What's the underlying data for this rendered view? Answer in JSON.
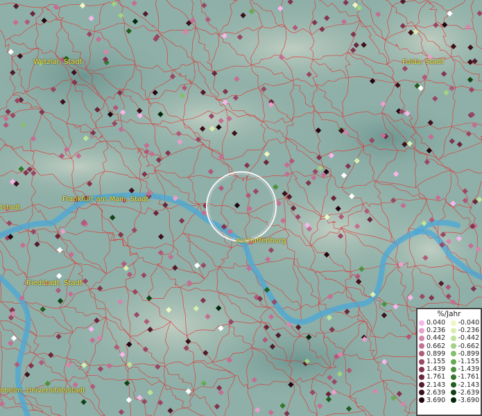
{
  "map": {
    "cities": [
      {
        "id": "wetzlar",
        "label": "Wetzlar, Stadt"
      },
      {
        "id": "fulda",
        "label": "Fulda, Stadt"
      },
      {
        "id": "frankfurt",
        "label": "Frankfurt am Main, Stadt"
      },
      {
        "id": "offenbach",
        "label": "tstadt"
      },
      {
        "id": "aschaffenburg",
        "label": "Aschaffenburg"
      },
      {
        "id": "riedstadt",
        "label": "Riedstadt, Stadt"
      },
      {
        "id": "mannheim",
        "label": "nheim, Universitätsstadt"
      }
    ],
    "legend": {
      "title": "%/Jahr",
      "positive": [
        {
          "value": "0.040",
          "color": "#f7b6ec"
        },
        {
          "value": "0.236",
          "color": "#e8a0cc"
        },
        {
          "value": "0.442",
          "color": "#d685ad"
        },
        {
          "value": "0.662",
          "color": "#c46e93"
        },
        {
          "value": "0.899",
          "color": "#b05a7a"
        },
        {
          "value": "1.155",
          "color": "#994763"
        },
        {
          "value": "1.439",
          "color": "#82354e"
        },
        {
          "value": "1.761",
          "color": "#6b263b"
        },
        {
          "value": "2.143",
          "color": "#541a2b"
        },
        {
          "value": "2.639",
          "color": "#3d101c"
        },
        {
          "value": "3.690",
          "color": "#220510"
        }
      ],
      "negative": [
        {
          "value": "-0.040",
          "color": "#f0f7c2"
        },
        {
          "value": "-0.236",
          "color": "#d9efb0"
        },
        {
          "value": "-0.442",
          "color": "#bfe29a"
        },
        {
          "value": "-0.662",
          "color": "#a2d282"
        },
        {
          "value": "-0.899",
          "color": "#84bf6a"
        },
        {
          "value": "-1.155",
          "color": "#66aa52"
        },
        {
          "value": "-1.439",
          "color": "#4c923e"
        },
        {
          "value": "-1.761",
          "color": "#35782e"
        },
        {
          "value": "-2.143",
          "color": "#225e20"
        },
        {
          "value": "-2.639",
          "color": "#134315"
        },
        {
          "value": "-3.690",
          "color": "#06280a"
        }
      ]
    },
    "colors": {
      "terrain": "#8fb0a8",
      "boundaries": "#e03030",
      "river": "#4aa8d8",
      "city_label": "#f2e640"
    }
  }
}
